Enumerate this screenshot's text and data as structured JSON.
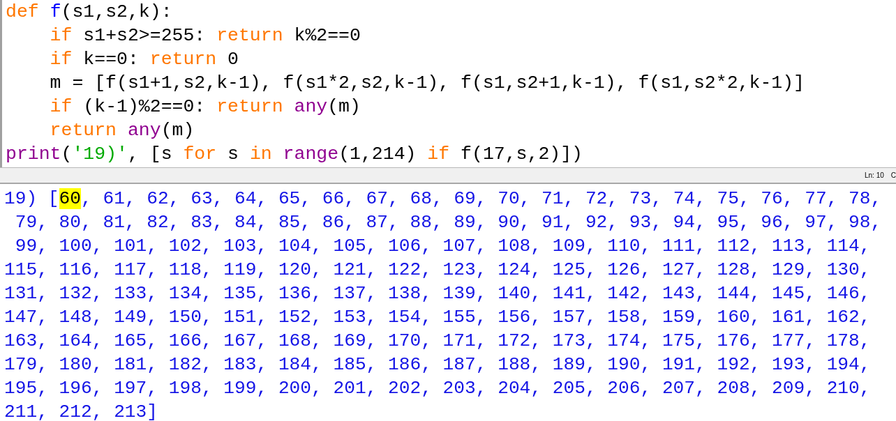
{
  "editor": {
    "lines": [
      [
        {
          "kind": "keyword",
          "text": "def "
        },
        {
          "kind": "defname",
          "text": "f"
        },
        {
          "kind": "plain",
          "text": "(s1,s2,k):"
        }
      ],
      [
        {
          "kind": "keyword",
          "text": "    if"
        },
        {
          "kind": "plain",
          "text": " s1+s2>=255: "
        },
        {
          "kind": "keyword",
          "text": "return"
        },
        {
          "kind": "plain",
          "text": " k%2==0"
        }
      ],
      [
        {
          "kind": "keyword",
          "text": "    if"
        },
        {
          "kind": "plain",
          "text": " k==0: "
        },
        {
          "kind": "keyword",
          "text": "return"
        },
        {
          "kind": "plain",
          "text": " 0"
        }
      ],
      [
        {
          "kind": "plain",
          "text": "    m = [f(s1+1,s2,k-1), f(s1*2,s2,k-1), f(s1,s2+1,k-1), f(s1,s2*2,k-1)]"
        }
      ],
      [
        {
          "kind": "keyword",
          "text": "    if"
        },
        {
          "kind": "plain",
          "text": " (k-1)%2==0: "
        },
        {
          "kind": "keyword",
          "text": "return "
        },
        {
          "kind": "builtin",
          "text": "any"
        },
        {
          "kind": "plain",
          "text": "(m)"
        }
      ],
      [
        {
          "kind": "keyword",
          "text": "    return "
        },
        {
          "kind": "builtin",
          "text": "any"
        },
        {
          "kind": "plain",
          "text": "(m)"
        }
      ],
      [
        {
          "kind": "builtin",
          "text": "print"
        },
        {
          "kind": "plain",
          "text": "("
        },
        {
          "kind": "string",
          "text": "'19)'"
        },
        {
          "kind": "plain",
          "text": ", [s "
        },
        {
          "kind": "keyword",
          "text": "for"
        },
        {
          "kind": "plain",
          "text": " s "
        },
        {
          "kind": "keyword",
          "text": "in "
        },
        {
          "kind": "builtin",
          "text": "range"
        },
        {
          "kind": "plain",
          "text": "(1,214) "
        },
        {
          "kind": "keyword",
          "text": "if"
        },
        {
          "kind": "plain",
          "text": " f(17,s,2)])"
        }
      ]
    ]
  },
  "status_bar": {
    "position": "Ln: 10",
    "column_cut": "C"
  },
  "output": {
    "lines": [
      [
        {
          "text": "19) [",
          "highlighted": false
        },
        {
          "text": "60",
          "highlighted": true
        },
        {
          "text": ", 61, 62, 63, 64, 65, 66, 67, 68, 69, 70, 71, 72, 73, 74, 75, 76, 77, 78,",
          "highlighted": false
        }
      ],
      [
        {
          "text": " 79, 80, 81, 82, 83, 84, 85, 86, 87, 88, 89, 90, 91, 92, 93, 94, 95, 96, 97, 98,",
          "highlighted": false
        }
      ],
      [
        {
          "text": " 99, 100, 101, 102, 103, 104, 105, 106, 107, 108, 109, 110, 111, 112, 113, 114,",
          "highlighted": false
        }
      ],
      [
        {
          "text": "115, 116, 117, 118, 119, 120, 121, 122, 123, 124, 125, 126, 127, 128, 129, 130,",
          "highlighted": false
        }
      ],
      [
        {
          "text": "131, 132, 133, 134, 135, 136, 137, 138, 139, 140, 141, 142, 143, 144, 145, 146,",
          "highlighted": false
        }
      ],
      [
        {
          "text": "147, 148, 149, 150, 151, 152, 153, 154, 155, 156, 157, 158, 159, 160, 161, 162,",
          "highlighted": false
        }
      ],
      [
        {
          "text": "163, 164, 165, 166, 167, 168, 169, 170, 171, 172, 173, 174, 175, 176, 177, 178,",
          "highlighted": false
        }
      ],
      [
        {
          "text": "179, 180, 181, 182, 183, 184, 185, 186, 187, 188, 189, 190, 191, 192, 193, 194,",
          "highlighted": false
        }
      ],
      [
        {
          "text": "195, 196, 197, 198, 199, 200, 201, 202, 203, 204, 205, 206, 207, 208, 209, 210,",
          "highlighted": false
        }
      ],
      [
        {
          "text": "211, 212, 213]",
          "highlighted": false
        }
      ]
    ]
  }
}
